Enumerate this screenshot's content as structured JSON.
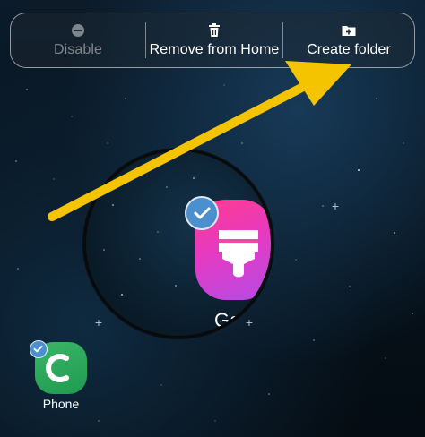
{
  "action_bar": {
    "disable": {
      "label": "Disable",
      "icon": "minus-circle-icon"
    },
    "remove": {
      "label": "Remove from Home",
      "icon": "trash-icon"
    },
    "create_folder": {
      "label": "Create folder",
      "icon": "folder-plus-icon"
    }
  },
  "magnifier": {
    "app_label": "Ga",
    "icon": "paint-brush-icon",
    "selected": true
  },
  "home": {
    "phone_app": {
      "label": "Phone",
      "icon": "phone-icon",
      "selected": true
    }
  },
  "colors": {
    "arrow": "#f5c400",
    "check_badge": "#4c8fcf",
    "phone_bg": "#2aa85a",
    "gallery_gradient_start": "#ff3c8f",
    "gallery_gradient_end": "#b44be6"
  }
}
